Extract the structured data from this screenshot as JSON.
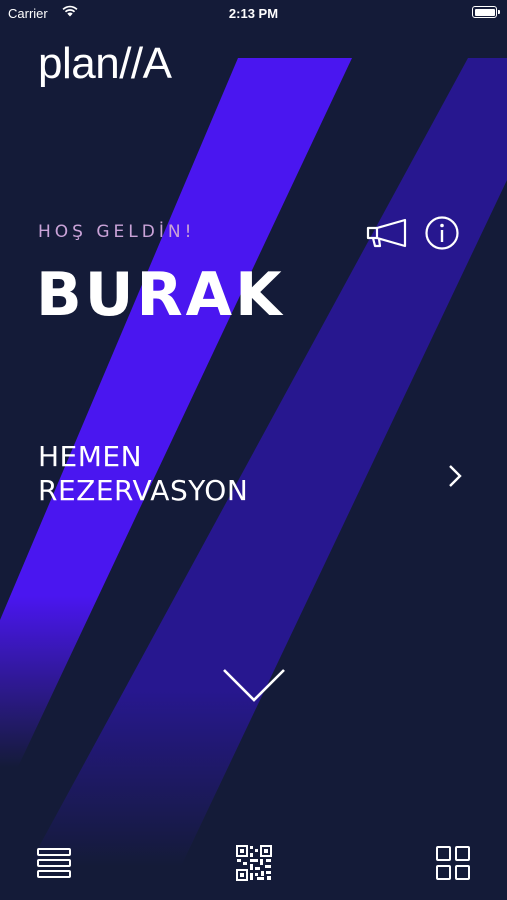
{
  "status_bar": {
    "carrier": "Carrier",
    "time": "2:13 PM",
    "battery_level": 1.0
  },
  "app": {
    "logo": "plan//A"
  },
  "greeting": {
    "welcome": "HOŞ GELDİN!",
    "name": "BURAK"
  },
  "header_icons": [
    "megaphone-icon",
    "info-icon"
  ],
  "reservation": {
    "line1": "HEMEN",
    "line2": "REZERVASYON"
  },
  "tab_bar": {
    "items": [
      "menu-icon",
      "qr-code-icon",
      "grid-icon"
    ]
  },
  "colors": {
    "background": "#141b38",
    "stripe_bright": "#4a16f0",
    "stripe_dark": "#27178f",
    "accent_text": "#caa3d8"
  }
}
